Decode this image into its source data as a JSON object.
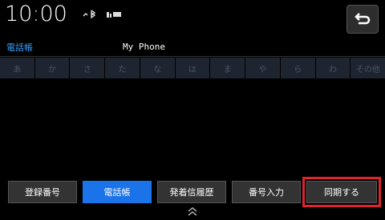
{
  "status": {
    "time": "10:00",
    "icons": [
      {
        "name": "bluetooth-signal-icon",
        "glyph": "✓ ʙ"
      },
      {
        "name": "battery-icon",
        "glyph": "▮▬"
      }
    ]
  },
  "header": {
    "label": "電話帳",
    "phone_name": "My Phone"
  },
  "index": [
    "あ",
    "か",
    "さ",
    "た",
    "な",
    "は",
    "ま",
    "や",
    "ら",
    "わ",
    "その他"
  ],
  "tabs": [
    {
      "label": "登録番号"
    },
    {
      "label": "電話帳"
    },
    {
      "label": "発着信履歴"
    },
    {
      "label": "番号入力"
    },
    {
      "label": "同期する"
    }
  ],
  "colors": {
    "accent": "#1a73e8",
    "highlight": "#e0242c",
    "label_blue": "#3aa0ff"
  }
}
